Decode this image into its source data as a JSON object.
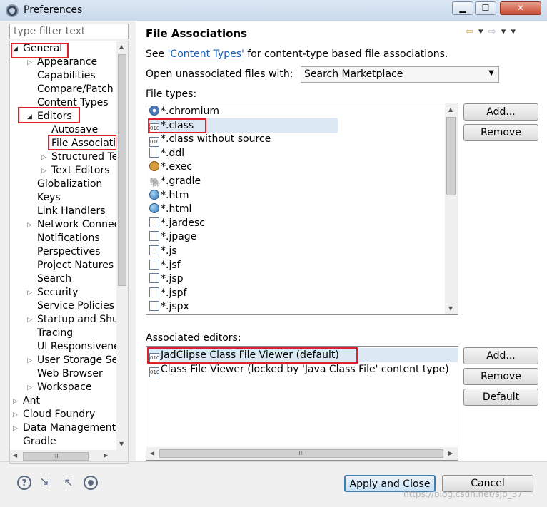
{
  "window": {
    "title": "Preferences",
    "min": "▁",
    "max": "☐",
    "close": "✕"
  },
  "filter": {
    "placeholder": "type filter text"
  },
  "tree": {
    "items": [
      {
        "label": "General",
        "toggle": "◢"
      },
      {
        "label": "Appearance",
        "toggle": "▷"
      },
      {
        "label": "Capabilities",
        "toggle": ""
      },
      {
        "label": "Compare/Patch",
        "toggle": ""
      },
      {
        "label": "Content Types",
        "toggle": ""
      },
      {
        "label": "Editors",
        "toggle": "◢"
      },
      {
        "label": "Autosave",
        "toggle": ""
      },
      {
        "label": "File Associations",
        "toggle": ""
      },
      {
        "label": "Structured Text Editors",
        "toggle": "▷"
      },
      {
        "label": "Text Editors",
        "toggle": "▷"
      },
      {
        "label": "Globalization",
        "toggle": ""
      },
      {
        "label": "Keys",
        "toggle": ""
      },
      {
        "label": "Link Handlers",
        "toggle": ""
      },
      {
        "label": "Network Connections",
        "toggle": "▷"
      },
      {
        "label": "Notifications",
        "toggle": ""
      },
      {
        "label": "Perspectives",
        "toggle": ""
      },
      {
        "label": "Project Natures",
        "toggle": ""
      },
      {
        "label": "Search",
        "toggle": ""
      },
      {
        "label": "Security",
        "toggle": "▷"
      },
      {
        "label": "Service Policies",
        "toggle": ""
      },
      {
        "label": "Startup and Shutdown",
        "toggle": "▷"
      },
      {
        "label": "Tracing",
        "toggle": ""
      },
      {
        "label": "UI Responsiveness",
        "toggle": ""
      },
      {
        "label": "User Storage Service",
        "toggle": "▷"
      },
      {
        "label": "Web Browser",
        "toggle": ""
      },
      {
        "label": "Workspace",
        "toggle": "▷"
      },
      {
        "label": "Ant",
        "toggle": "▷"
      },
      {
        "label": "Cloud Foundry",
        "toggle": "▷"
      },
      {
        "label": "Data Management",
        "toggle": "▷"
      },
      {
        "label": "Gradle",
        "toggle": ""
      }
    ]
  },
  "page": {
    "title": "File Associations",
    "nav": [
      "⇦",
      "▾",
      "⇨",
      "▾",
      "▾"
    ],
    "see_prefix": "See ",
    "see_link": "'Content Types'",
    "see_suffix": " for content-type based file associations.",
    "open_label": "Open unassociated files with:",
    "open_value": "Search Marketplace",
    "file_types_label": "File types:",
    "file_types": [
      {
        "name": "*.chromium",
        "icon": "chrome"
      },
      {
        "name": "*.class",
        "icon": "class"
      },
      {
        "name": "*.class without source",
        "icon": "class"
      },
      {
        "name": "*.ddl",
        "icon": "doc"
      },
      {
        "name": "*.exec",
        "icon": "gear"
      },
      {
        "name": "*.gradle",
        "icon": "elephant"
      },
      {
        "name": "*.htm",
        "icon": "globe"
      },
      {
        "name": "*.html",
        "icon": "globe"
      },
      {
        "name": "*.jardesc",
        "icon": "doc"
      },
      {
        "name": "*.jpage",
        "icon": "doc"
      },
      {
        "name": "*.js",
        "icon": "doc"
      },
      {
        "name": "*.jsf",
        "icon": "doc"
      },
      {
        "name": "*.jsp",
        "icon": "doc"
      },
      {
        "name": "*.jspf",
        "icon": "doc"
      },
      {
        "name": "*.jspx",
        "icon": "doc"
      }
    ],
    "ft_buttons": {
      "add": "Add...",
      "remove": "Remove"
    },
    "assoc_label": "Associated editors:",
    "associated_editors": [
      "JadClipse Class File Viewer (default)",
      "Class File Viewer (locked by 'Java Class File' content type)"
    ],
    "ae_buttons": {
      "add": "Add...",
      "remove": "Remove",
      "default": "Default"
    }
  },
  "footer": {
    "apply_close": "Apply and Close",
    "cancel": "Cancel",
    "help": "?",
    "watermark": "https://blog.csdn.net/sjp_37"
  }
}
